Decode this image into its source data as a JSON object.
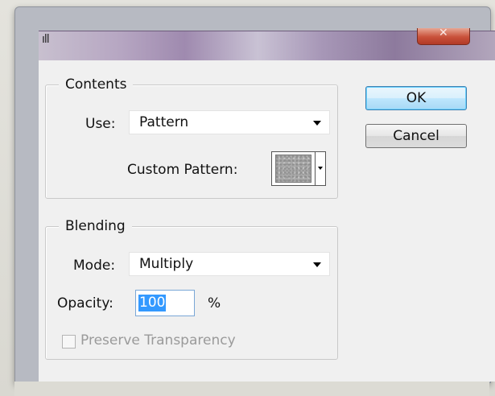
{
  "window": {
    "title_fragment": "ıll",
    "close_glyph": "✕"
  },
  "contents": {
    "legend": "Contents",
    "use_label": "Use:",
    "use_value": "Pattern",
    "custom_pattern_label": "Custom Pattern:"
  },
  "blending": {
    "legend": "Blending",
    "mode_label": "Mode:",
    "mode_value": "Multiply",
    "opacity_label": "Opacity:",
    "opacity_value": "100",
    "opacity_unit": "%",
    "preserve_label": "Preserve Transparency",
    "preserve_checked": false,
    "preserve_enabled": false
  },
  "buttons": {
    "ok_label": "OK",
    "cancel_label": "Cancel"
  },
  "colors": {
    "default_button_border": "#3c7fb1",
    "selection_highlight": "#3399ff",
    "dialog_background": "#f0f0f0"
  }
}
